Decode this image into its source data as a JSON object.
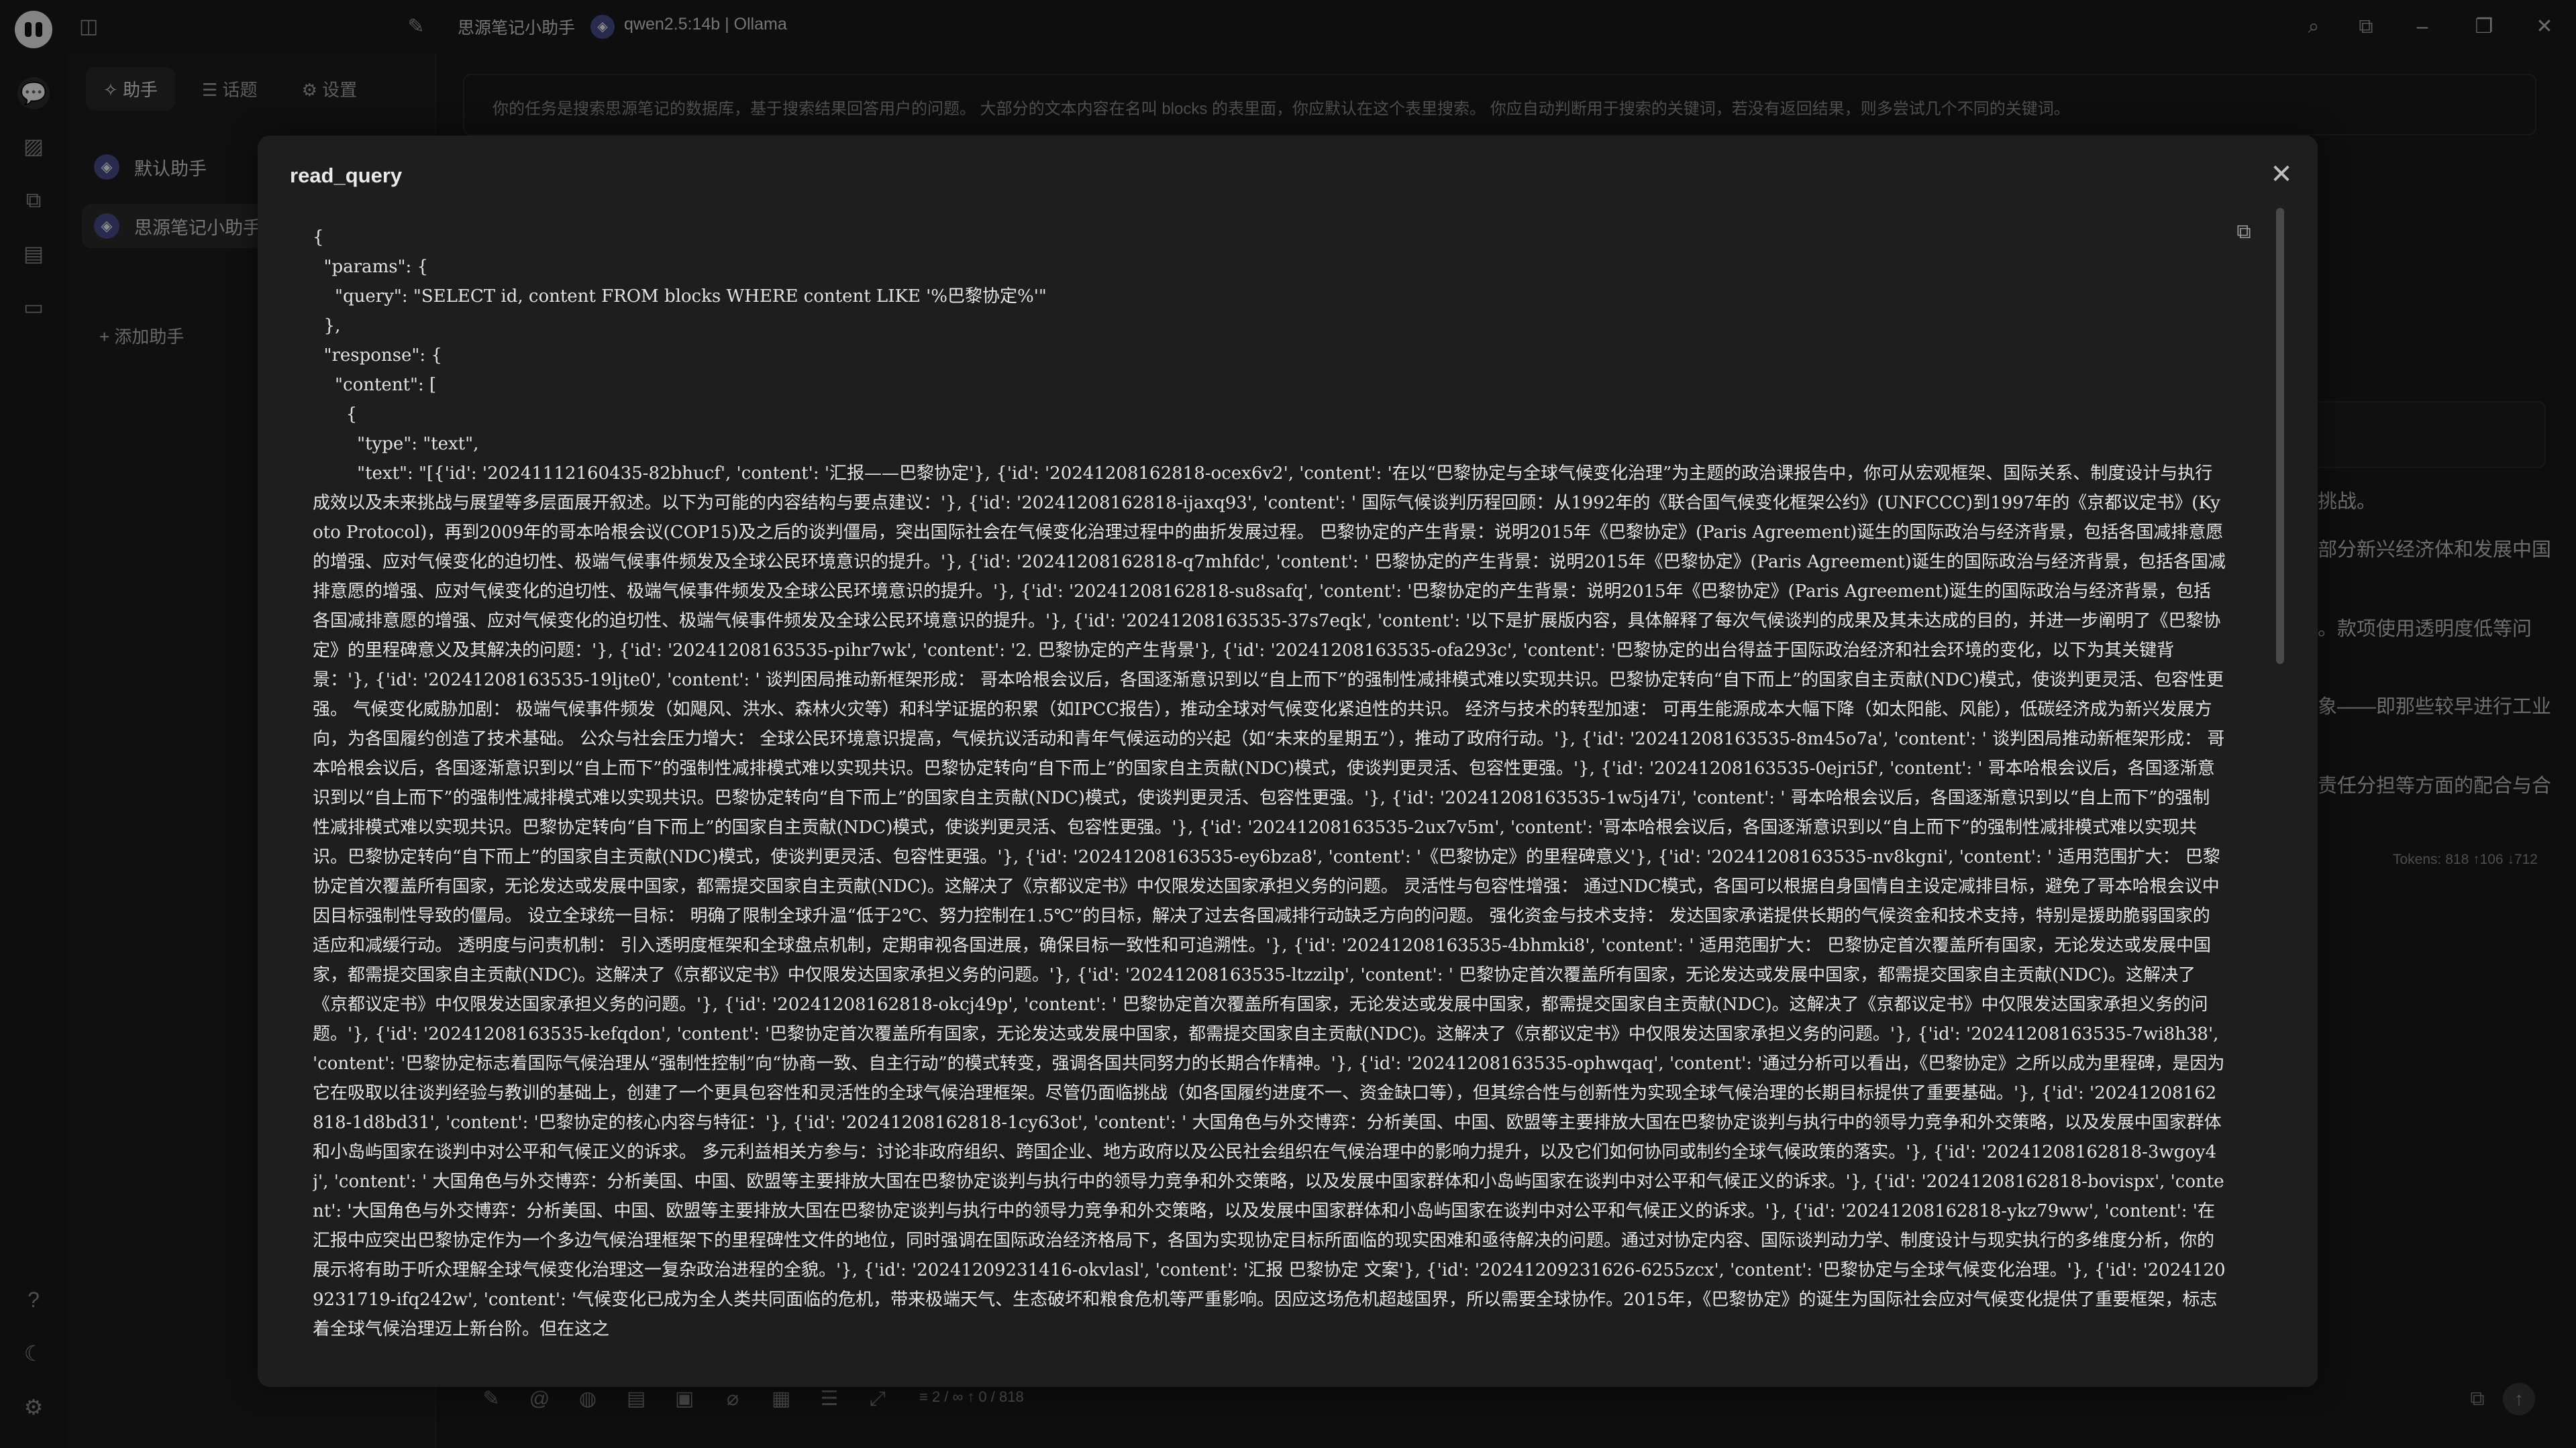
{
  "titlebar": {
    "assistant_name": "思源笔记小助手",
    "model_label": "qwen2.5:14b | Ollama"
  },
  "sidebar": {
    "tabs": [
      {
        "label": "✧ 助手"
      },
      {
        "label": "☰ 话题"
      },
      {
        "label": "⚙ 设置"
      }
    ],
    "assistants": [
      {
        "label": "默认助手"
      },
      {
        "label": "思源笔记小助手"
      }
    ],
    "add_label": "+ 添加助手"
  },
  "main": {
    "system_prompt": "你的任务是搜索思源笔记的数据库，基于搜索结果回答用户的问题。 大部分的文本内容在名叫 blocks 的表里面，你应默认在这个表里搜索。 你应自动判断用于搜索的关键词，若没有返回结果，则多尝试几个不同的关键词。",
    "background_lines": [
      "挑战。",
      "部分新兴经济体和发展中国",
      "。款项使用透明度低等问",
      "象——即那些较早进行工业",
      "责任分担等方面的配合与合"
    ],
    "tokens": "Tokens: 818 ↑106 ↓712"
  },
  "inputbar": {
    "counter": "≡ 2 / ∞   ↑ 0 / 818"
  },
  "modal": {
    "title": "read_query",
    "code_lines": [
      "{",
      "  \"params\": {",
      "    \"query\": \"SELECT id, content FROM blocks WHERE content LIKE '%巴黎协定%'\"",
      "  },",
      "  \"response\": {",
      "    \"content\": [",
      "      {",
      "        \"type\": \"text\","
    ],
    "text_value": "        \"text\": \"[{'id': '20241112160435-82bhucf', 'content': '汇报——巴黎协定'}, {'id': '20241208162818-ocex6v2', 'content': '在以“巴黎协定与全球气候变化治理”为主题的政治课报告中，你可从宏观框架、国际关系、制度设计与执行成效以及未来挑战与展望等多层面展开叙述。以下为可能的内容结构与要点建议：'}, {'id': '20241208162818-ijaxq93', 'content': ' 国际气候谈判历程回顾：从1992年的《联合国气候变化框架公约》(UNFCCC)到1997年的《京都议定书》(Kyoto Protocol)，再到2009年的哥本哈根会议(COP15)及之后的谈判僵局，突出国际社会在气候变化治理过程中的曲折发展过程。 巴黎协定的产生背景：说明2015年《巴黎协定》(Paris Agreement)诞生的国际政治与经济背景，包括各国减排意愿的增强、应对气候变化的迫切性、极端气候事件频发及全球公民环境意识的提升。'}, {'id': '20241208162818-q7mhfdc', 'content': ' 巴黎协定的产生背景：说明2015年《巴黎协定》(Paris Agreement)诞生的国际政治与经济背景，包括各国减排意愿的增强、应对气候变化的迫切性、极端气候事件频发及全球公民环境意识的提升。'}, {'id': '20241208162818-su8safq', 'content': '巴黎协定的产生背景：说明2015年《巴黎协定》(Paris Agreement)诞生的国际政治与经济背景，包括各国减排意愿的增强、应对气候变化的迫切性、极端气候事件频发及全球公民环境意识的提升。'}, {'id': '20241208163535-37s7eqk', 'content': '以下是扩展版内容，具体解释了每次气候谈判的成果及其未达成的目的，并进一步阐明了《巴黎协定》的里程碑意义及其解决的问题：'}, {'id': '20241208163535-pihr7wk', 'content': '2. 巴黎协定的产生背景'}, {'id': '20241208163535-ofa293c', 'content': '巴黎协定的出台得益于国际政治经济和社会环境的变化，以下为其关键背景：'}, {'id': '20241208163535-19ljte0', 'content': ' 谈判困局推动新框架形成： 哥本哈根会议后，各国逐渐意识到以“自上而下”的强制性减排模式难以实现共识。巴黎协定转向“自下而上”的国家自主贡献(NDC)模式，使谈判更灵活、包容性更强。 气候变化威胁加剧： 极端气候事件频发（如飓风、洪水、森林火灾等）和科学证据的积累（如IPCC报告），推动全球对气候变化紧迫性的共识。 经济与技术的转型加速： 可再生能源成本大幅下降（如太阳能、风能），低碳经济成为新兴发展方向，为各国履约创造了技术基础。 公众与社会压力增大： 全球公民环境意识提高，气候抗议活动和青年气候运动的兴起（如“未来的星期五”），推动了政府行动。'}, {'id': '20241208163535-8m45o7a', 'content': ' 谈判困局推动新框架形成： 哥本哈根会议后，各国逐渐意识到以“自上而下”的强制性减排模式难以实现共识。巴黎协定转向“自下而上”的国家自主贡献(NDC)模式，使谈判更灵活、包容性更强。'}, {'id': '20241208163535-0ejri5f', 'content': ' 哥本哈根会议后，各国逐渐意识到以“自上而下”的强制性减排模式难以实现共识。巴黎协定转向“自下而上”的国家自主贡献(NDC)模式，使谈判更灵活、包容性更强。'}, {'id': '20241208163535-1w5j47i', 'content': ' 哥本哈根会议后，各国逐渐意识到以“自上而下”的强制性减排模式难以实现共识。巴黎协定转向“自下而上”的国家自主贡献(NDC)模式，使谈判更灵活、包容性更强。'}, {'id': '20241208163535-2ux7v5m', 'content': '哥本哈根会议后，各国逐渐意识到以“自上而下”的强制性减排模式难以实现共识。巴黎协定转向“自下而上”的国家自主贡献(NDC)模式，使谈判更灵活、包容性更强。'}, {'id': '20241208163535-ey6bza8', 'content': '《巴黎协定》的里程碑意义'}, {'id': '20241208163535-nv8kgni', 'content': ' 适用范围扩大： 巴黎协定首次覆盖所有国家，无论发达或发展中国家，都需提交国家自主贡献(NDC)。这解决了《京都议定书》中仅限发达国家承担义务的问题。 灵活性与包容性增强： 通过NDC模式，各国可以根据自身国情自主设定减排目标，避免了哥本哈根会议中因目标强制性导致的僵局。 设立全球统一目标： 明确了限制全球升温“低于2℃、努力控制在1.5℃”的目标，解决了过去各国减排行动缺乏方向的问题。 强化资金与技术支持： 发达国家承诺提供长期的气候资金和技术支持，特别是援助脆弱国家的适应和减缓行动。 透明度与问责机制： 引入透明度框架和全球盘点机制，定期审视各国进展，确保目标一致性和可追溯性。'}, {'id': '20241208163535-4bhmki8', 'content': ' 适用范围扩大： 巴黎协定首次覆盖所有国家，无论发达或发展中国家，都需提交国家自主贡献(NDC)。这解决了《京都议定书》中仅限发达国家承担义务的问题。'}, {'id': '20241208163535-ltzzilp', 'content': ' 巴黎协定首次覆盖所有国家，无论发达或发展中国家，都需提交国家自主贡献(NDC)。这解决了《京都议定书》中仅限发达国家承担义务的问题。'}, {'id': '20241208162818-okcj49p', 'content': ' 巴黎协定首次覆盖所有国家，无论发达或发展中国家，都需提交国家自主贡献(NDC)。这解决了《京都议定书》中仅限发达国家承担义务的问题。'}, {'id': '20241208163535-kefqdon', 'content': '巴黎协定首次覆盖所有国家，无论发达或发展中国家，都需提交国家自主贡献(NDC)。这解决了《京都议定书》中仅限发达国家承担义务的问题。'}, {'id': '20241208163535-7wi8h38', 'content': '巴黎协定标志着国际气候治理从“强制性控制”向“协商一致、自主行动”的模式转变，强调各国共同努力的长期合作精神。'}, {'id': '20241208163535-ophwqaq', 'content': '通过分析可以看出，《巴黎协定》之所以成为里程碑，是因为它在吸取以往谈判经验与教训的基础上，创建了一个更具包容性和灵活性的全球气候治理框架。尽管仍面临挑战（如各国履约进度不一、资金缺口等），但其综合性与创新性为实现全球气候治理的长期目标提供了重要基础。'}, {'id': '20241208162818-1d8bd31', 'content': '巴黎协定的核心内容与特征：'}, {'id': '20241208162818-1cy63ot', 'content': ' 大国角色与外交博弈：分析美国、中国、欧盟等主要排放大国在巴黎协定谈判与执行中的领导力竞争和外交策略，以及发展中国家群体和小岛屿国家在谈判中对公平和气候正义的诉求。 多元利益相关方参与：讨论非政府组织、跨国企业、地方政府以及公民社会组织在气候治理中的影响力提升，以及它们如何协同或制约全球气候政策的落实。'}, {'id': '20241208162818-3wgoy4j', 'content': ' 大国角色与外交博弈：分析美国、中国、欧盟等主要排放大国在巴黎协定谈判与执行中的领导力竞争和外交策略，以及发展中国家群体和小岛屿国家在谈判中对公平和气候正义的诉求。'}, {'id': '20241208162818-bovispx', 'content': '大国角色与外交博弈：分析美国、中国、欧盟等主要排放大国在巴黎协定谈判与执行中的领导力竞争和外交策略，以及发展中国家群体和小岛屿国家在谈判中对公平和气候正义的诉求。'}, {'id': '20241208162818-ykz79ww', 'content': '在汇报中应突出巴黎协定作为一个多边气候治理框架下的里程碑性文件的地位，同时强调在国际政治经济格局下，各国为实现协定目标所面临的现实困难和亟待解决的问题。通过对协定内容、国际谈判动力学、制度设计与现实执行的多维度分析，你的展示将有助于听众理解全球气候变化治理这一复杂政治进程的全貌。'}, {'id': '20241209231416-okvlasl', 'content': '汇报 巴黎协定 文案'}, {'id': '20241209231626-6255zcx', 'content': '巴黎协定与全球气候变化治理。'}, {'id': '20241209231719-ifq242w', 'content': '气候变化已成为全人类共同面临的危机，带来极端天气、生态破坏和粮食危机等严重影响。因应这场危机超越国界，所以需要全球协作。2015年，《巴黎协定》的诞生为国际社会应对气候变化提供了重要框架，标志着全球气候治理迈上新台阶。但在这之"
  }
}
